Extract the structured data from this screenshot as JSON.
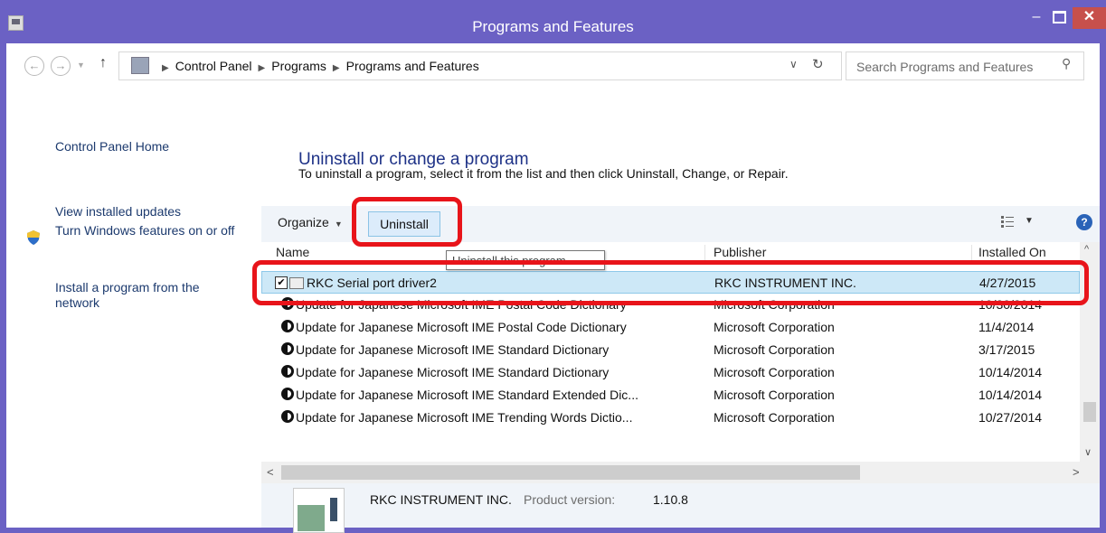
{
  "window": {
    "title": "Programs and Features",
    "controls": {
      "minimize": "–",
      "maximize": "",
      "close": "✕"
    },
    "colors": {
      "frame": "#6b61c4",
      "close": "#c7504c",
      "highlight": "#e8141a",
      "link": "#1c3a6e",
      "heading": "#1e3287"
    }
  },
  "address": {
    "back": "←",
    "forward": "→",
    "up": "↑",
    "crumbs": [
      "Control Panel",
      "Programs",
      "Programs and Features"
    ],
    "dropdown": "∨",
    "refresh": "↻",
    "search_placeholder": "Search Programs and Features",
    "search_icon": "search-icon"
  },
  "sidebar": {
    "items": [
      "Control Panel Home",
      "View installed updates",
      "Turn Windows features on or off",
      "Install a program from the network"
    ]
  },
  "main": {
    "title": "Uninstall or change a program",
    "description": "To uninstall a program, select it from the list and then click Uninstall, Change, or Repair."
  },
  "toolbar": {
    "organize": "Organize",
    "organize_arrow": "▼",
    "uninstall": "Uninstall",
    "view_dropdown": "▼",
    "help": "?"
  },
  "tooltip": "Uninstall this program",
  "list": {
    "columns": {
      "name": "Name",
      "publisher": "Publisher",
      "installed": "Installed On"
    },
    "selected_check": "✔",
    "rows": [
      {
        "name": "RKC Serial port driver2",
        "publisher": "RKC INSTRUMENT INC.",
        "installed": "4/27/2015"
      },
      {
        "name": "Update for Japanese Microsoft IME Postal Code Dictionary",
        "publisher": "Microsoft Corporation",
        "installed": "10/30/2014"
      },
      {
        "name": "Update for Japanese Microsoft IME Postal Code Dictionary",
        "publisher": "Microsoft Corporation",
        "installed": "11/4/2014"
      },
      {
        "name": "Update for Japanese Microsoft IME Standard Dictionary",
        "publisher": "Microsoft Corporation",
        "installed": "3/17/2015"
      },
      {
        "name": "Update for Japanese Microsoft IME Standard Dictionary",
        "publisher": "Microsoft Corporation",
        "installed": "10/14/2014"
      },
      {
        "name": "Update for Japanese Microsoft IME Standard Extended Dic...",
        "publisher": "Microsoft Corporation",
        "installed": "10/14/2014"
      },
      {
        "name": "Update for Japanese Microsoft IME Trending Words Dictio...",
        "publisher": "Microsoft Corporation",
        "installed": "10/27/2014"
      }
    ],
    "scroll": {
      "up": "^",
      "down": "∨",
      "left": "<",
      "right": ">"
    }
  },
  "details": {
    "publisher": "RKC INSTRUMENT INC.",
    "version_label": "Product version:",
    "version": "1.10.8"
  }
}
